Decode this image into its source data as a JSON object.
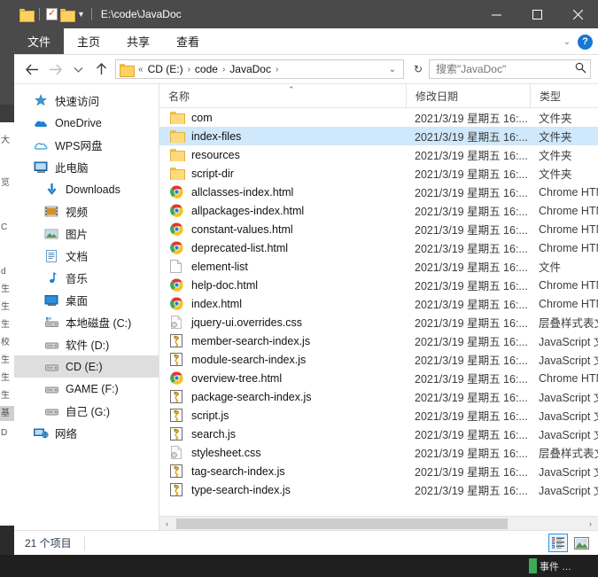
{
  "window": {
    "title_path": "E:\\code\\JavaDoc",
    "quick_access": [
      {
        "name": "folder-icon",
        "label": "文件夹"
      },
      {
        "name": "properties-icon",
        "label": "属性"
      },
      {
        "name": "new-folder-icon",
        "label": "新建文件夹"
      }
    ],
    "controls": {
      "minimize": "—",
      "maximize": "□",
      "close": "✕"
    }
  },
  "ribbon": {
    "tabs": [
      {
        "label": "文件",
        "active": true
      },
      {
        "label": "主页",
        "active": false
      },
      {
        "label": "共享",
        "active": false
      },
      {
        "label": "查看",
        "active": false
      }
    ],
    "collapse_caret": "⌄",
    "help_label": "?"
  },
  "addressbar": {
    "back_label": "←",
    "forward_label": "→",
    "history_caret": "⌄",
    "up_label": "↑",
    "breadcrumb_prefix": "«",
    "breadcrumbs": [
      "CD (E:)",
      "code",
      "JavaDoc"
    ],
    "breadcrumb_separator": "›",
    "path_caret": "⌄",
    "refresh_label": "↻"
  },
  "search": {
    "placeholder": "搜索\"JavaDoc\"",
    "icon": "search-icon"
  },
  "sidebar": {
    "items": [
      {
        "label": "快速访问",
        "icon": "pin-star-icon",
        "indent": 0,
        "selected": false
      },
      {
        "label": "OneDrive",
        "icon": "cloud-icon",
        "indent": 0,
        "selected": false
      },
      {
        "label": "WPS网盘",
        "icon": "cloud-outline-icon",
        "indent": 0,
        "selected": false
      },
      {
        "label": "此电脑",
        "icon": "this-pc-icon",
        "indent": 0,
        "selected": false
      },
      {
        "label": "Downloads",
        "icon": "download-arrow-icon",
        "indent": 1,
        "selected": false
      },
      {
        "label": "视频",
        "icon": "video-icon",
        "indent": 1,
        "selected": false
      },
      {
        "label": "图片",
        "icon": "pictures-icon",
        "indent": 1,
        "selected": false
      },
      {
        "label": "文档",
        "icon": "documents-icon",
        "indent": 1,
        "selected": false
      },
      {
        "label": "音乐",
        "icon": "music-note-icon",
        "indent": 1,
        "selected": false
      },
      {
        "label": "桌面",
        "icon": "desktop-icon",
        "indent": 1,
        "selected": false
      },
      {
        "label": "本地磁盘 (C:)",
        "icon": "system-drive-icon",
        "indent": 1,
        "selected": false
      },
      {
        "label": "软件 (D:)",
        "icon": "drive-icon",
        "indent": 1,
        "selected": false
      },
      {
        "label": "CD (E:)",
        "icon": "drive-icon",
        "indent": 1,
        "selected": true
      },
      {
        "label": "GAME (F:)",
        "icon": "drive-icon",
        "indent": 1,
        "selected": false
      },
      {
        "label": "自己 (G:)",
        "icon": "drive-icon",
        "indent": 1,
        "selected": false
      },
      {
        "label": "网络",
        "icon": "network-icon",
        "indent": 0,
        "selected": false
      }
    ]
  },
  "filelist": {
    "columns": [
      {
        "label": "名称",
        "key": "name"
      },
      {
        "label": "修改日期",
        "key": "date"
      },
      {
        "label": "类型",
        "key": "type"
      }
    ],
    "sort": {
      "column": "名称",
      "direction": "asc",
      "glyph": "⌃"
    },
    "rows": [
      {
        "name": "com",
        "date": "2021/3/19 星期五 16:...",
        "type": "文件夹",
        "icon": "folder-icon",
        "selected": false
      },
      {
        "name": "index-files",
        "date": "2021/3/19 星期五 16:...",
        "type": "文件夹",
        "icon": "folder-icon",
        "selected": true
      },
      {
        "name": "resources",
        "date": "2021/3/19 星期五 16:...",
        "type": "文件夹",
        "icon": "folder-icon",
        "selected": false
      },
      {
        "name": "script-dir",
        "date": "2021/3/19 星期五 16:...",
        "type": "文件夹",
        "icon": "folder-icon",
        "selected": false
      },
      {
        "name": "allclasses-index.html",
        "date": "2021/3/19 星期五 16:...",
        "type": "Chrome HTM",
        "icon": "chrome-icon",
        "selected": false
      },
      {
        "name": "allpackages-index.html",
        "date": "2021/3/19 星期五 16:...",
        "type": "Chrome HTM",
        "icon": "chrome-icon",
        "selected": false
      },
      {
        "name": "constant-values.html",
        "date": "2021/3/19 星期五 16:...",
        "type": "Chrome HTM",
        "icon": "chrome-icon",
        "selected": false
      },
      {
        "name": "deprecated-list.html",
        "date": "2021/3/19 星期五 16:...",
        "type": "Chrome HTM",
        "icon": "chrome-icon",
        "selected": false
      },
      {
        "name": "element-list",
        "date": "2021/3/19 星期五 16:...",
        "type": "文件",
        "icon": "document-icon",
        "selected": false
      },
      {
        "name": "help-doc.html",
        "date": "2021/3/19 星期五 16:...",
        "type": "Chrome HTM",
        "icon": "chrome-icon",
        "selected": false
      },
      {
        "name": "index.html",
        "date": "2021/3/19 星期五 16:...",
        "type": "Chrome HTM",
        "icon": "chrome-icon",
        "selected": false
      },
      {
        "name": "jquery-ui.overrides.css",
        "date": "2021/3/19 星期五 16:...",
        "type": "层叠样式表文",
        "icon": "css-icon",
        "selected": false
      },
      {
        "name": "member-search-index.js",
        "date": "2021/3/19 星期五 16:...",
        "type": "JavaScript 文",
        "icon": "js-icon",
        "selected": false
      },
      {
        "name": "module-search-index.js",
        "date": "2021/3/19 星期五 16:...",
        "type": "JavaScript 文",
        "icon": "js-icon",
        "selected": false
      },
      {
        "name": "overview-tree.html",
        "date": "2021/3/19 星期五 16:...",
        "type": "Chrome HTM",
        "icon": "chrome-icon",
        "selected": false
      },
      {
        "name": "package-search-index.js",
        "date": "2021/3/19 星期五 16:...",
        "type": "JavaScript 文",
        "icon": "js-icon",
        "selected": false
      },
      {
        "name": "script.js",
        "date": "2021/3/19 星期五 16:...",
        "type": "JavaScript 文",
        "icon": "js-icon",
        "selected": false
      },
      {
        "name": "search.js",
        "date": "2021/3/19 星期五 16:...",
        "type": "JavaScript 文",
        "icon": "js-icon",
        "selected": false
      },
      {
        "name": "stylesheet.css",
        "date": "2021/3/19 星期五 16:...",
        "type": "层叠样式表文",
        "icon": "css-icon",
        "selected": false
      },
      {
        "name": "tag-search-index.js",
        "date": "2021/3/19 星期五 16:...",
        "type": "JavaScript 文",
        "icon": "js-icon",
        "selected": false
      },
      {
        "name": "type-search-index.js",
        "date": "2021/3/19 星期五 16:...",
        "type": "JavaScript 文",
        "icon": "js-icon",
        "selected": false
      }
    ]
  },
  "hscroll": {
    "left_arrow": "‹",
    "right_arrow": "›"
  },
  "statusbar": {
    "item_count": "21 个项目",
    "views": [
      {
        "name": "details-view-button",
        "active": true
      },
      {
        "name": "large-icons-view-button",
        "active": false
      }
    ]
  },
  "taskbar": {
    "item_label": "事件 …"
  },
  "colors": {
    "titlebar": "#4a4a4a",
    "selection_row": "#cfe8fb",
    "selection_nav": "#dedede",
    "accent": "#1976d2",
    "folder": "#ffd97a"
  }
}
